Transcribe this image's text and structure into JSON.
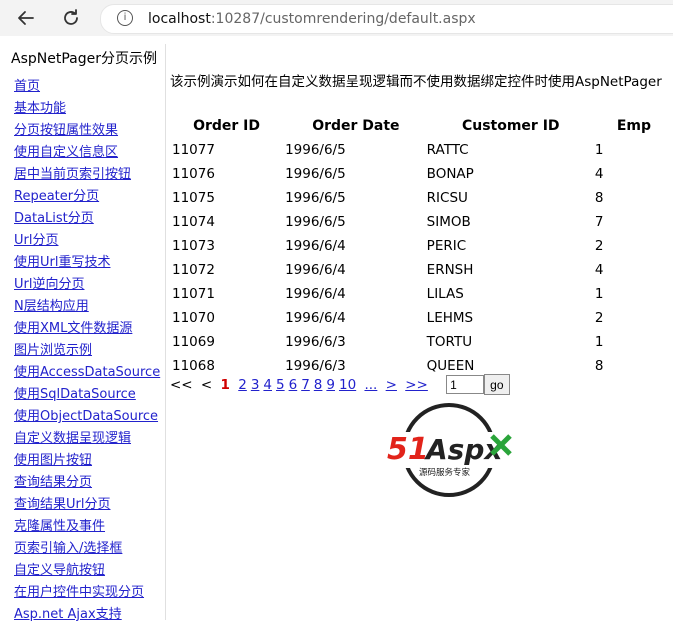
{
  "browser": {
    "url_host": "localhost",
    "url_rest": ":10287/customrendering/default.aspx"
  },
  "sidebar": {
    "title": "AspNetPager分页示例",
    "items": [
      "首页",
      "基本功能",
      "分页按钮属性效果",
      "使用自定义信息区",
      "居中当前页索引按钮",
      "Repeater分页",
      "DataList分页",
      "Url分页",
      "使用Url重写技术",
      "Url逆向分页",
      "N层结构应用",
      "使用XML文件数据源",
      "图片浏览示例",
      "使用AccessDataSource",
      "使用SqlDataSource",
      "使用ObjectDataSource",
      "自定义数据呈现逻辑",
      "使用图片按钮",
      "查询结果分页",
      "查询结果Url分页",
      "克隆属性及事件",
      "页索引输入/选择框",
      "自定义导航按钮",
      "在用户控件中实现分页",
      "Asp.net Ajax支持"
    ]
  },
  "content": {
    "description": "该示例演示如何在自定义数据呈现逻辑而不使用数据绑定控件时使用AspNetPager",
    "columns": [
      "Order ID",
      "Order Date",
      "Customer ID",
      "Emp"
    ],
    "rows": [
      [
        "11077",
        "1996/6/5",
        "RATTC",
        "1"
      ],
      [
        "11076",
        "1996/6/5",
        "BONAP",
        "4"
      ],
      [
        "11075",
        "1996/6/5",
        "RICSU",
        "8"
      ],
      [
        "11074",
        "1996/6/5",
        "SIMOB",
        "7"
      ],
      [
        "11073",
        "1996/6/4",
        "PERIC",
        "2"
      ],
      [
        "11072",
        "1996/6/4",
        "ERNSH",
        "4"
      ],
      [
        "11071",
        "1996/6/4",
        "LILAS",
        "1"
      ],
      [
        "11070",
        "1996/6/4",
        "LEHMS",
        "2"
      ],
      [
        "11069",
        "1996/6/3",
        "TORTU",
        "1"
      ],
      [
        "11068",
        "1996/6/3",
        "QUEEN",
        "8"
      ]
    ]
  },
  "pager": {
    "first": "<<",
    "prev": "<",
    "current": "1",
    "pages": [
      "2",
      "3",
      "4",
      "5",
      "6",
      "7",
      "8",
      "9",
      "10"
    ],
    "more": "...",
    "next": ">",
    "last": ">>",
    "input_value": "1",
    "go_label": "go"
  },
  "logo": {
    "brand": "51Aspx",
    "tagline": "源码服务专家",
    "colors": {
      "red": "#e2231a",
      "green": "#2aa43a",
      "ring": "#222222"
    }
  }
}
